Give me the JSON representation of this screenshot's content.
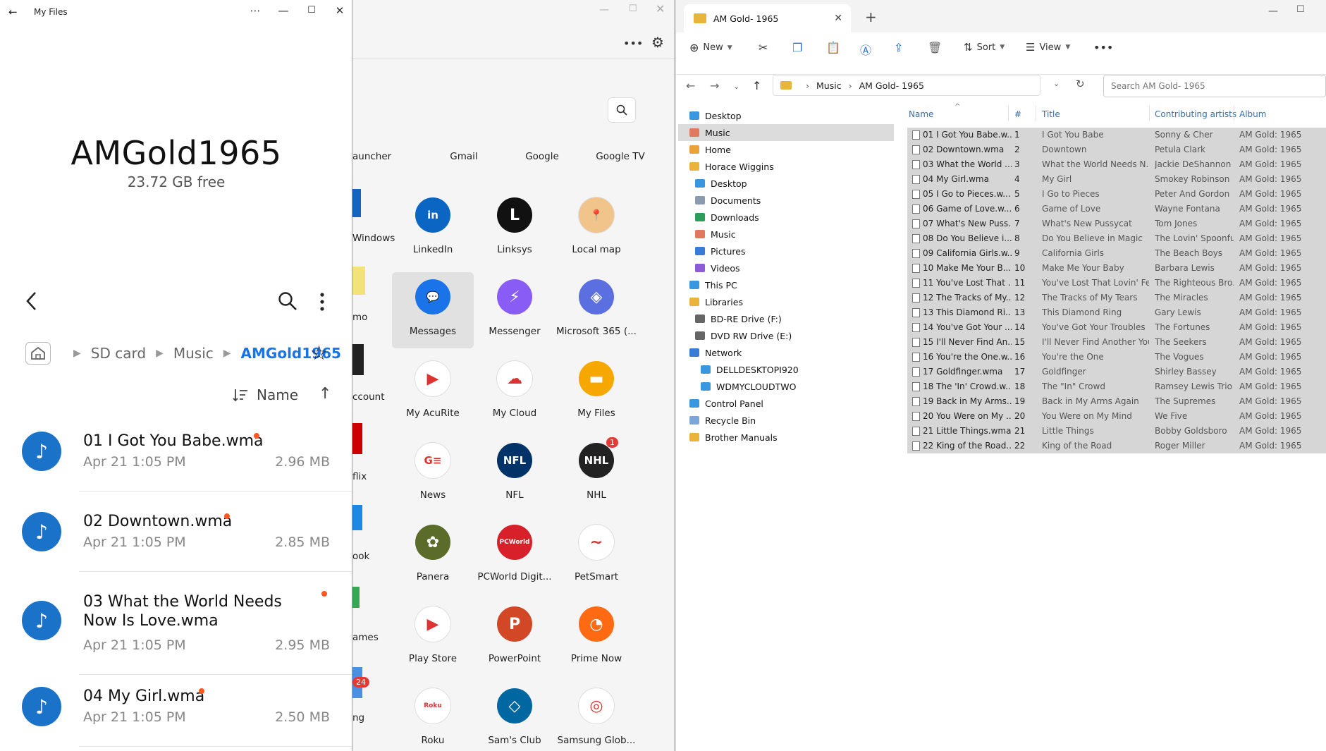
{
  "myfiles": {
    "window_title": "My Files",
    "folder_name": "AMGold1965",
    "free_space": "23.72 GB free",
    "breadcrumb": [
      "SD card",
      "Music",
      "AMGold1965"
    ],
    "sort_label": "Name",
    "files": [
      {
        "name": "01 I Got You Babe.wma",
        "date": "Apr 21 1:05 PM",
        "size": "2.96 MB"
      },
      {
        "name": "02 Downtown.wma",
        "date": "Apr 21 1:05 PM",
        "size": "2.85 MB"
      },
      {
        "name": "03 What the World Needs Now Is Love.wma",
        "date": "Apr 21 1:05 PM",
        "size": "2.95 MB"
      },
      {
        "name": "04 My Girl.wma",
        "date": "Apr 21 1:05 PM",
        "size": "2.50 MB"
      }
    ]
  },
  "launcher": {
    "partial_labels": [
      "auncher",
      "Windows",
      "mo",
      "ccount",
      "flix",
      "ook",
      "ames",
      "ng"
    ],
    "row0_labels": [
      "Gmail",
      "Google",
      "Google TV"
    ],
    "apps": [
      {
        "label": "LinkedIn",
        "glyph": "in",
        "color": "#0a66c2"
      },
      {
        "label": "Linksys",
        "glyph": "L",
        "color": "#111111"
      },
      {
        "label": "Local map",
        "glyph": "📍",
        "color": "#f0c48a"
      },
      {
        "label": "Messages",
        "glyph": "💬",
        "color": "#1a73e8"
      },
      {
        "label": "Messenger",
        "glyph": "⚡",
        "color": "#8a5cf6"
      },
      {
        "label": "Microsoft 365 (...",
        "glyph": "◈",
        "color": "#5b6fe0"
      },
      {
        "label": "My AcuRite",
        "glyph": "▶",
        "color": "#ffffff"
      },
      {
        "label": "My Cloud",
        "glyph": "☁",
        "color": "#ffffff"
      },
      {
        "label": "My Files",
        "glyph": "▬",
        "color": "#f6a800"
      },
      {
        "label": "News",
        "glyph": "G≡",
        "color": "#ffffff"
      },
      {
        "label": "NFL",
        "glyph": "NFL",
        "color": "#013369"
      },
      {
        "label": "NHL",
        "glyph": "NHL",
        "color": "#222222",
        "badge": "1"
      },
      {
        "label": "Panera",
        "glyph": "✿",
        "color": "#5a6b2a"
      },
      {
        "label": "PCWorld Digit...",
        "glyph": "PCWorld",
        "color": "#d8202a"
      },
      {
        "label": "PetSmart",
        "glyph": "~",
        "color": "#ffffff"
      },
      {
        "label": "Play Store",
        "glyph": "▶",
        "color": "#ffffff"
      },
      {
        "label": "PowerPoint",
        "glyph": "P",
        "color": "#d24726"
      },
      {
        "label": "Prime Now",
        "glyph": "◔",
        "color": "#ff6a13"
      },
      {
        "label": "Roku",
        "glyph": "Roku",
        "color": "#ffffff"
      },
      {
        "label": "Sam's Club",
        "glyph": "◇",
        "color": "#0067a0"
      },
      {
        "label": "Samsung Glob...",
        "glyph": "◎",
        "color": "#ffffff"
      }
    ],
    "partial_badge": "24"
  },
  "explorer": {
    "tab_title": "AM Gold- 1965",
    "toolbar": {
      "new": "New",
      "sort": "Sort",
      "view": "View"
    },
    "path": [
      "Music",
      "AM Gold- 1965"
    ],
    "search_placeholder": "Search AM Gold- 1965",
    "nav": [
      {
        "label": "Desktop",
        "color": "#3a96dd"
      },
      {
        "label": "Music",
        "color": "#e07a5f",
        "selected": true
      },
      {
        "label": "Home",
        "color": "#e8a33b"
      },
      {
        "label": "Horace Wiggins",
        "color": "#e8b43b"
      },
      {
        "label": "Desktop",
        "color": "#3a96dd"
      },
      {
        "label": "Documents",
        "color": "#8a9bb0"
      },
      {
        "label": "Downloads",
        "color": "#2e9d5b"
      },
      {
        "label": "Music",
        "color": "#e07a5f"
      },
      {
        "label": "Pictures",
        "color": "#3a7bd5"
      },
      {
        "label": "Videos",
        "color": "#8e5cd6"
      },
      {
        "label": "This PC",
        "color": "#3a96dd"
      },
      {
        "label": "Libraries",
        "color": "#e8b43b"
      },
      {
        "label": "BD-RE Drive (F:)",
        "color": "#666666"
      },
      {
        "label": "DVD RW Drive (E:)",
        "color": "#666666"
      },
      {
        "label": "Network",
        "color": "#3a7bd5"
      },
      {
        "label": "DELLDESKTOPI920",
        "color": "#3a96dd"
      },
      {
        "label": "WDMYCLOUDTWO",
        "color": "#3a96dd"
      },
      {
        "label": "Control Panel",
        "color": "#3a96dd"
      },
      {
        "label": "Recycle Bin",
        "color": "#7aa7d8"
      },
      {
        "label": "Brother Manuals",
        "color": "#e8b43b"
      }
    ],
    "columns": [
      "Name",
      "#",
      "Title",
      "Contributing artists",
      "Album"
    ],
    "rows": [
      [
        "01 I Got You Babe.w...",
        "1",
        "I Got You Babe",
        "Sonny & Cher",
        "AM Gold: 1965"
      ],
      [
        "02 Downtown.wma",
        "2",
        "Downtown",
        "Petula Clark",
        "AM Gold: 1965"
      ],
      [
        "03 What the World ...",
        "3",
        "What the World Needs N...",
        "Jackie DeShannon",
        "AM Gold: 1965"
      ],
      [
        "04 My Girl.wma",
        "4",
        "My Girl",
        "Smokey Robinson",
        "AM Gold: 1965"
      ],
      [
        "05 I Go to Pieces.w...",
        "5",
        "I Go to Pieces",
        "Peter And Gordon",
        "AM Gold: 1965"
      ],
      [
        "06 Game of Love.w...",
        "6",
        "Game of Love",
        "Wayne Fontana",
        "AM Gold: 1965"
      ],
      [
        "07 What's New Puss...",
        "7",
        "What's New Pussycat",
        "Tom Jones",
        "AM Gold: 1965"
      ],
      [
        "08 Do You Believe i...",
        "8",
        "Do You Believe in Magic",
        "The Lovin' Spoonful",
        "AM Gold: 1965"
      ],
      [
        "09 California Girls.w...",
        "9",
        "California Girls",
        "The Beach Boys",
        "AM Gold: 1965"
      ],
      [
        "10 Make Me Your B...",
        "10",
        "Make Me Your Baby",
        "Barbara Lewis",
        "AM Gold: 1965"
      ],
      [
        "11 You've Lost That ...",
        "11",
        "You've Lost That Lovin' Fe...",
        "The Righteous Bro...",
        "AM Gold: 1965"
      ],
      [
        "12 The Tracks of My...",
        "12",
        "The Tracks of My Tears",
        "The Miracles",
        "AM Gold: 1965"
      ],
      [
        "13 This Diamond Ri...",
        "13",
        "This Diamond Ring",
        "Gary Lewis",
        "AM Gold: 1965"
      ],
      [
        "14 You've Got Your ...",
        "14",
        "You've Got Your Troubles",
        "The Fortunes",
        "AM Gold: 1965"
      ],
      [
        "15 I'll Never Find An...",
        "15",
        "I'll Never Find Another You",
        "The Seekers",
        "AM Gold: 1965"
      ],
      [
        "16 You're the One.w...",
        "16",
        "You're the One",
        "The Vogues",
        "AM Gold: 1965"
      ],
      [
        "17 Goldfinger.wma",
        "17",
        "Goldfinger",
        "Shirley Bassey",
        "AM Gold: 1965"
      ],
      [
        "18 The 'In' Crowd.w...",
        "18",
        "The \"In\" Crowd",
        "Ramsey Lewis Trio",
        "AM Gold: 1965"
      ],
      [
        "19 Back in My Arms...",
        "19",
        "Back in My Arms Again",
        "The Supremes",
        "AM Gold: 1965"
      ],
      [
        "20 You Were on My ...",
        "20",
        "You Were on My Mind",
        "We Five",
        "AM Gold: 1965"
      ],
      [
        "21 Little Things.wma",
        "21",
        "Little Things",
        "Bobby Goldsboro",
        "AM Gold: 1965"
      ],
      [
        "22 King of the Road...",
        "22",
        "King of the Road",
        "Roger Miller",
        "AM Gold: 1965"
      ]
    ]
  }
}
